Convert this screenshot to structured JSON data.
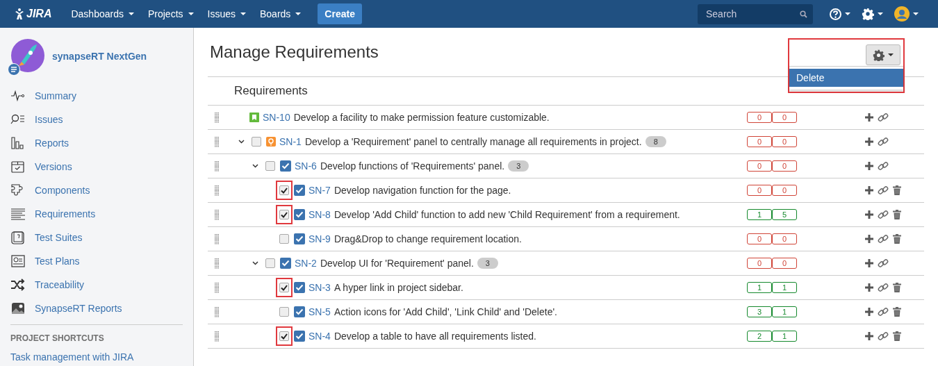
{
  "header": {
    "logo": "JIRA",
    "menus": [
      {
        "label": "Dashboards"
      },
      {
        "label": "Projects"
      },
      {
        "label": "Issues"
      },
      {
        "label": "Boards"
      }
    ],
    "create": "Create",
    "search": {
      "placeholder": "Search"
    }
  },
  "sidebar": {
    "project": "synapseRT NextGen",
    "items": [
      {
        "label": "Summary"
      },
      {
        "label": "Issues"
      },
      {
        "label": "Reports"
      },
      {
        "label": "Versions"
      },
      {
        "label": "Components"
      },
      {
        "label": "Requirements"
      },
      {
        "label": "Test Suites"
      },
      {
        "label": "Test Plans"
      },
      {
        "label": "Traceability"
      },
      {
        "label": "SynapseRT Reports"
      }
    ],
    "shortcuts_heading": "PROJECT SHORTCUTS",
    "shortcuts": [
      "Task management with JIRA"
    ]
  },
  "page": {
    "title": "Manage Requirements",
    "section": "Requirements",
    "actions_menu": {
      "expanded": true,
      "highlighted": true,
      "items": [
        {
          "label": "Delete",
          "selected": true
        }
      ]
    }
  },
  "rows": [
    {
      "kind": "story",
      "key": "SN-10",
      "summary": "Develop a facility to make permission feature customizable.",
      "coverage": {
        "color": "#d04437",
        "values": [
          "0",
          "0"
        ]
      },
      "deletable": false
    },
    {
      "kind": "epic",
      "key": "SN-1",
      "summary": "Develop a 'Requirement' panel to centrally manage all requirements in project.",
      "count": "8",
      "checked": false,
      "expanded": true,
      "coverage": {
        "color": "#d04437",
        "values": [
          "0",
          "0"
        ]
      },
      "deletable": false,
      "children": [
        {
          "kind": "requirement",
          "key": "SN-6",
          "summary": "Develop functions of 'Requirements' panel.",
          "count": "3",
          "checked": false,
          "expanded": true,
          "coverage": {
            "color": "#d04437",
            "values": [
              "0",
              "0"
            ]
          },
          "deletable": false,
          "children": [
            {
              "kind": "requirement",
              "key": "SN-7",
              "summary": "Develop navigation function for the page.",
              "checked": true,
              "highlighted": true,
              "coverage": {
                "color": "#d04437",
                "values": [
                  "0",
                  "0"
                ]
              },
              "deletable": true
            },
            {
              "kind": "requirement",
              "key": "SN-8",
              "summary": "Develop 'Add Child' function to add new 'Child Requirement' from a requirement.",
              "checked": true,
              "highlighted": true,
              "coverage": {
                "color": "#14892c",
                "values": [
                  "1",
                  "5"
                ]
              },
              "deletable": true
            },
            {
              "kind": "requirement",
              "key": "SN-9",
              "summary": "Drag&Drop to change requirement location.",
              "checked": false,
              "highlighted": false,
              "coverage": {
                "color": "#d04437",
                "values": [
                  "0",
                  "0"
                ]
              },
              "deletable": true
            }
          ]
        },
        {
          "kind": "requirement",
          "key": "SN-2",
          "summary": "Develop UI for 'Requirement' panel.",
          "count": "3",
          "checked": false,
          "expanded": true,
          "coverage": {
            "color": "#d04437",
            "values": [
              "0",
              "0"
            ]
          },
          "deletable": false,
          "children": [
            {
              "kind": "requirement",
              "key": "SN-3",
              "summary": "A hyper link in project sidebar.",
              "checked": true,
              "highlighted": true,
              "coverage": {
                "color": "#14892c",
                "values": [
                  "1",
                  "1"
                ]
              },
              "deletable": true
            },
            {
              "kind": "requirement",
              "key": "SN-5",
              "summary": "Action icons for 'Add Child', 'Link Child' and 'Delete'.",
              "checked": false,
              "highlighted": false,
              "coverage": {
                "color": "#14892c",
                "values": [
                  "3",
                  "1"
                ]
              },
              "deletable": true
            },
            {
              "kind": "requirement",
              "key": "SN-4",
              "summary": "Develop a table to have all requirements listed.",
              "checked": true,
              "highlighted": true,
              "coverage": {
                "color": "#14892c",
                "values": [
                  "2",
                  "1"
                ]
              },
              "deletable": true
            }
          ]
        }
      ]
    }
  ]
}
